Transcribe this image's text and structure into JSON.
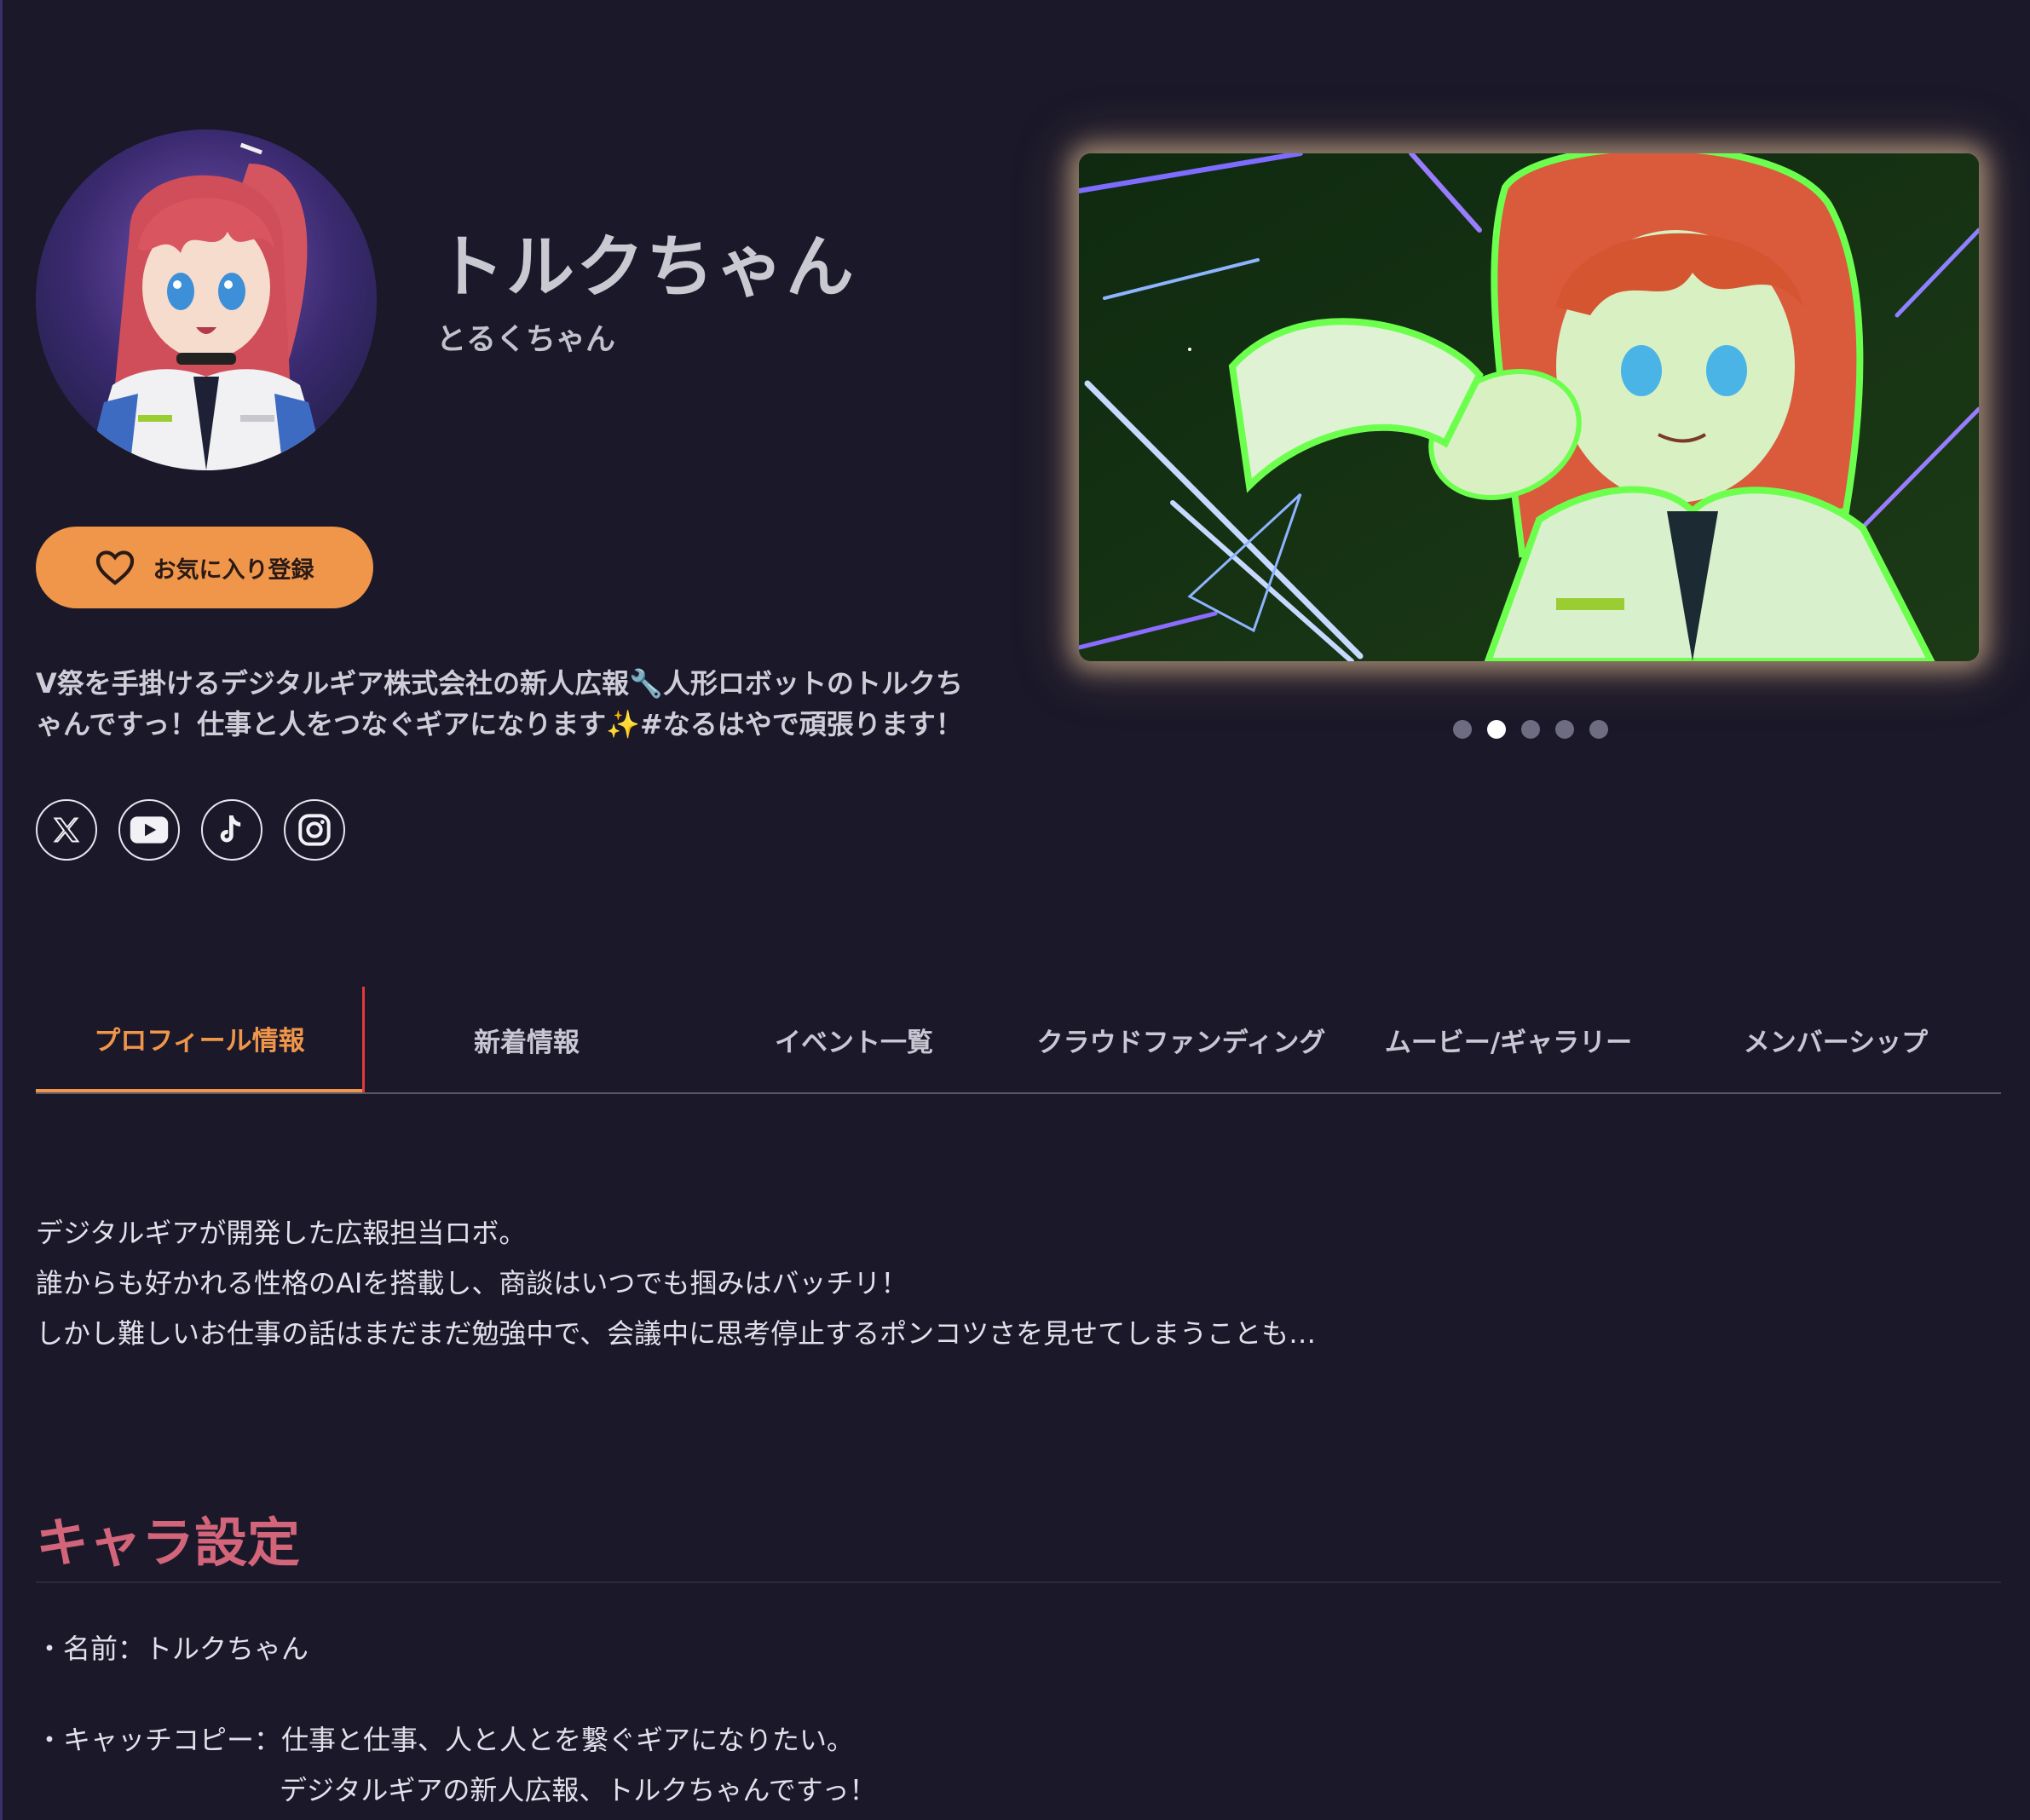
{
  "profile": {
    "name": "トルクちゃん",
    "kana": "とるくちゃん",
    "favorite_label": "お気に入り登録",
    "bio": "V祭を手掛けるデジタルギア株式会社の新人広報🔧人形ロボットのトルクちゃんですっ！仕事と人をつなぐギアになります✨#なるはやで頑張ります！",
    "socials": [
      {
        "icon": "x-icon"
      },
      {
        "icon": "youtube-icon"
      },
      {
        "icon": "tiktok-icon"
      },
      {
        "icon": "instagram-icon"
      }
    ]
  },
  "carousel": {
    "slide_count": 5,
    "active_index": 1
  },
  "tabs": [
    {
      "label": "プロフィール情報",
      "active": true
    },
    {
      "label": "新着情報",
      "active": false
    },
    {
      "label": "イベント一覧",
      "active": false
    },
    {
      "label": "クラウドファンディング",
      "active": false
    },
    {
      "label": "ムービー/ギャラリー",
      "active": false
    },
    {
      "label": "メンバーシップ",
      "active": false
    }
  ],
  "intro": [
    "デジタルギアが開発した広報担当ロボ。",
    "誰からも好かれる性格のAIを搭載し、商談はいつでも掴みはバッチリ！",
    "しかし難しいお仕事の話はまだまだ勉強中で、会議中に思考停止するポンコツさを見せてしまうことも…"
  ],
  "character_settings": {
    "title": "キャラ設定",
    "name_line": "・名前：トルクちゃん",
    "catchcopy_line1": "・キャッチコピー：仕事と仕事、人と人とを繋ぐギアになりたい。",
    "catchcopy_line2": "デジタルギアの新人広報、トルクちゃんですっ！"
  },
  "colors": {
    "background": "#1a1829",
    "accent": "#f0964a",
    "section_title": "#d2657a"
  }
}
